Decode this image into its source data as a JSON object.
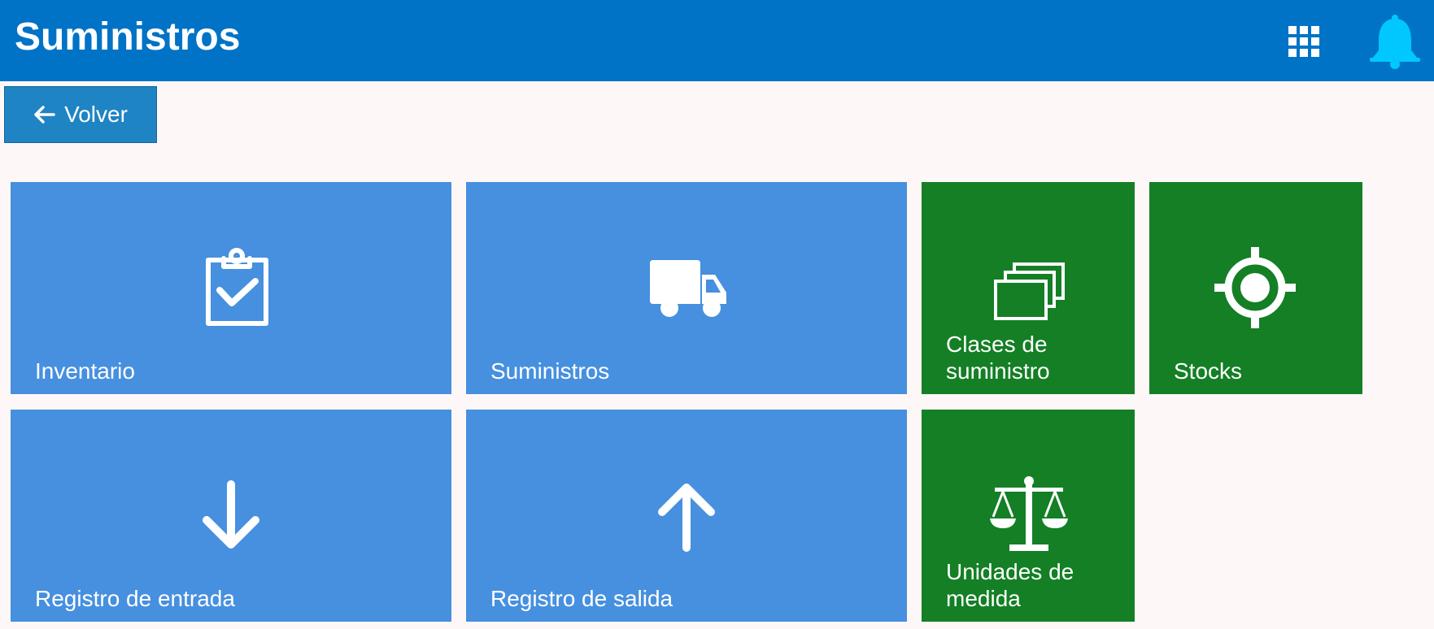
{
  "header": {
    "title": "Suministros",
    "background": "#0073c6",
    "apps_icon": "grid-icon",
    "notification_icon": "bell-icon",
    "notification_color": "#00c8ff"
  },
  "toolbar": {
    "back_label": "Volver",
    "back_icon": "arrow-left-icon"
  },
  "tiles": [
    {
      "label": "Inventario",
      "icon": "clipboard-check-icon",
      "color": "#4690df"
    },
    {
      "label": "Suministros",
      "icon": "truck-icon",
      "color": "#4690df"
    },
    {
      "label": "Clases de suministro",
      "icon": "stacked-windows-icon",
      "color": "#147f25"
    },
    {
      "label": "Stocks",
      "icon": "target-icon",
      "color": "#147f25"
    },
    {
      "label": "Registro de entrada",
      "icon": "arrow-down-icon",
      "color": "#4690df"
    },
    {
      "label": "Registro de salida",
      "icon": "arrow-up-icon",
      "color": "#4690df"
    },
    {
      "label": "Unidades de medida",
      "icon": "scales-icon",
      "color": "#147f25"
    }
  ]
}
